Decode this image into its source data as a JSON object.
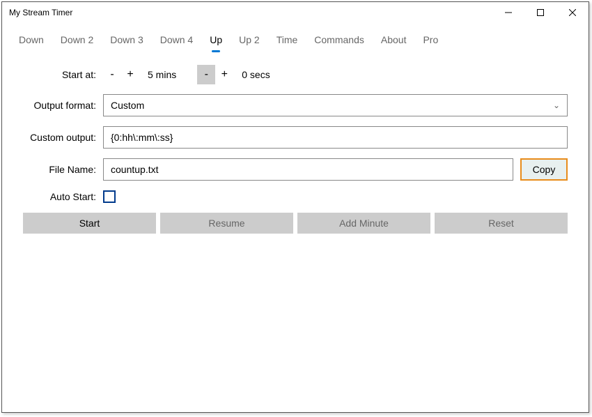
{
  "window": {
    "title": "My Stream Timer"
  },
  "tabs": [
    {
      "label": "Down"
    },
    {
      "label": "Down 2"
    },
    {
      "label": "Down 3"
    },
    {
      "label": "Down 4"
    },
    {
      "label": "Up"
    },
    {
      "label": "Up 2"
    },
    {
      "label": "Time"
    },
    {
      "label": "Commands"
    },
    {
      "label": "About"
    },
    {
      "label": "Pro"
    }
  ],
  "active_tab_index": 4,
  "form": {
    "start_at_label": "Start at:",
    "mins_value": "5 mins",
    "secs_value": "0 secs",
    "minus": "-",
    "plus": "+",
    "output_format_label": "Output format:",
    "output_format_value": "Custom",
    "custom_output_label": "Custom output:",
    "custom_output_value": "{0:hh\\:mm\\:ss}",
    "file_name_label": "File Name:",
    "file_name_value": "countup.txt",
    "copy_label": "Copy",
    "auto_start_label": "Auto Start:"
  },
  "actions": {
    "start": "Start",
    "resume": "Resume",
    "add_minute": "Add Minute",
    "reset": "Reset"
  }
}
